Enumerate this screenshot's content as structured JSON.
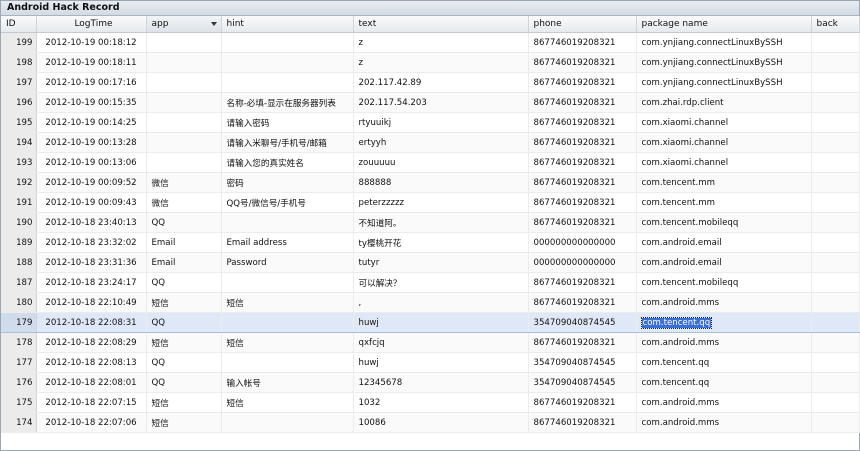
{
  "window": {
    "title": "Android Hack Record"
  },
  "columns": {
    "id": "ID",
    "logtime": "LogTime",
    "app": "app",
    "hint": "hint",
    "text": "text",
    "phone": "phone",
    "package": "package name",
    "back": "back"
  },
  "rows": [
    {
      "id": "199",
      "logtime": "2012-10-19 00:18:12",
      "app": "",
      "hint": "",
      "text": "z",
      "phone": "867746019208321",
      "package": "com.ynjiang.connectLinuxBySSH",
      "back": ""
    },
    {
      "id": "198",
      "logtime": "2012-10-19 00:18:11",
      "app": "",
      "hint": "",
      "text": "z",
      "phone": "867746019208321",
      "package": "com.ynjiang.connectLinuxBySSH",
      "back": ""
    },
    {
      "id": "197",
      "logtime": "2012-10-19 00:17:16",
      "app": "",
      "hint": "",
      "text": "202.117.42.89",
      "phone": "867746019208321",
      "package": "com.ynjiang.connectLinuxBySSH",
      "back": ""
    },
    {
      "id": "196",
      "logtime": "2012-10-19 00:15:35",
      "app": "",
      "hint": "名称-必填-显示在服务器列表",
      "text": "202.117.54.203",
      "phone": "867746019208321",
      "package": "com.zhai.rdp.client",
      "back": ""
    },
    {
      "id": "195",
      "logtime": "2012-10-19 00:14:25",
      "app": "",
      "hint": "请输入密码",
      "text": "rtyuuikj",
      "phone": "867746019208321",
      "package": "com.xiaomi.channel",
      "back": ""
    },
    {
      "id": "194",
      "logtime": "2012-10-19 00:13:28",
      "app": "",
      "hint": "请输入米聊号/手机号/邮箱",
      "text": "ertyyh",
      "phone": "867746019208321",
      "package": "com.xiaomi.channel",
      "back": ""
    },
    {
      "id": "193",
      "logtime": "2012-10-19 00:13:06",
      "app": "",
      "hint": "请输入您的真实姓名",
      "text": "zouuuuu",
      "phone": "867746019208321",
      "package": "com.xiaomi.channel",
      "back": ""
    },
    {
      "id": "192",
      "logtime": "2012-10-19 00:09:52",
      "app": "微信",
      "hint": "密码",
      "text": "888888",
      "phone": "867746019208321",
      "package": "com.tencent.mm",
      "back": ""
    },
    {
      "id": "191",
      "logtime": "2012-10-19 00:09:43",
      "app": "微信",
      "hint": "QQ号/微信号/手机号",
      "text": "peterzzzzz",
      "phone": "867746019208321",
      "package": "com.tencent.mm",
      "back": ""
    },
    {
      "id": "190",
      "logtime": "2012-10-18 23:40:13",
      "app": "QQ",
      "hint": "",
      "text": "不知道阿。",
      "phone": "867746019208321",
      "package": "com.tencent.mobileqq",
      "back": ""
    },
    {
      "id": "189",
      "logtime": "2012-10-18 23:32:02",
      "app": "Email",
      "hint": "Email address",
      "text": "ty樱桃开花",
      "phone": "000000000000000",
      "package": "com.android.email",
      "back": ""
    },
    {
      "id": "188",
      "logtime": "2012-10-18 23:31:36",
      "app": "Email",
      "hint": "Password",
      "text": "tutyr",
      "phone": "000000000000000",
      "package": "com.android.email",
      "back": ""
    },
    {
      "id": "187",
      "logtime": "2012-10-18 23:24:17",
      "app": "QQ",
      "hint": "",
      "text": "可以解决？",
      "phone": "867746019208321",
      "package": "com.tencent.mobileqq",
      "back": ""
    },
    {
      "id": "180",
      "logtime": "2012-10-18 22:10:49",
      "app": "短信",
      "hint": "短信",
      "text": ",",
      "phone": "867746019208321",
      "package": "com.android.mms",
      "back": ""
    },
    {
      "id": "179",
      "logtime": "2012-10-18 22:08:31",
      "app": "QQ",
      "hint": "",
      "text": "huwj",
      "phone": "354709040874545",
      "package": "com.tencent.qq",
      "back": "",
      "selected": true
    },
    {
      "id": "178",
      "logtime": "2012-10-18 22:08:29",
      "app": "短信",
      "hint": "短信",
      "text": "qxfcjq",
      "phone": "867746019208321",
      "package": "com.android.mms",
      "back": ""
    },
    {
      "id": "177",
      "logtime": "2012-10-18 22:08:13",
      "app": "QQ",
      "hint": "",
      "text": "huwj",
      "phone": "354709040874545",
      "package": "com.tencent.qq",
      "back": ""
    },
    {
      "id": "176",
      "logtime": "2012-10-18 22:08:01",
      "app": "QQ",
      "hint": "输入帐号",
      "text": "12345678",
      "phone": "354709040874545",
      "package": "com.tencent.qq",
      "back": ""
    },
    {
      "id": "175",
      "logtime": "2012-10-18 22:07:15",
      "app": "短信",
      "hint": "短信",
      "text": "1032",
      "phone": "867746019208321",
      "package": "com.android.mms",
      "back": ""
    },
    {
      "id": "174",
      "logtime": "2012-10-18 22:07:06",
      "app": "短信",
      "hint": "",
      "text": "10086",
      "phone": "867746019208321",
      "package": "com.android.mms",
      "back": ""
    }
  ]
}
